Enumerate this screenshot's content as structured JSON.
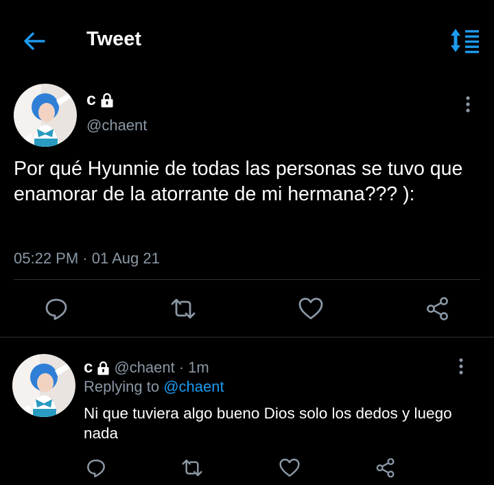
{
  "header": {
    "title": "Tweet"
  },
  "tweet": {
    "display_name": "c",
    "handle": "@chaent",
    "text": "Por qué Hyunnie de todas las personas se tuvo que enamorar de la atorrante de mi hermana??? ):",
    "timestamp": "05:22 PM · 01 Aug 21"
  },
  "reply": {
    "display_name": "c",
    "handle": "@chaent",
    "separator": "·",
    "time": "1m",
    "replying_to_label": "Replying to",
    "replying_to_handle": "@chaent",
    "text": "Ni que tuviera algo bueno Dios solo los dedos y luego nada"
  },
  "icons": {
    "back": "arrow-left-icon",
    "sort": "sort-icon",
    "lock": "lock-icon",
    "more": "more-vertical-icon",
    "reply": "reply-icon",
    "retweet": "retweet-icon",
    "like": "heart-icon",
    "share": "share-icon"
  },
  "colors": {
    "accent": "#1d9bf0",
    "background": "#000000",
    "muted": "#8b98a5"
  }
}
